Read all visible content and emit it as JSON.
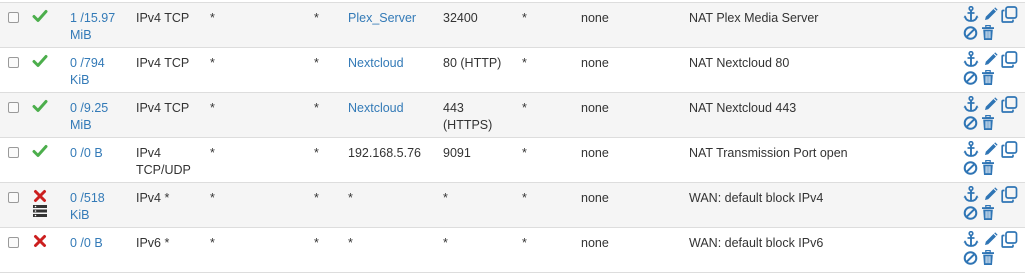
{
  "colors": {
    "link": "#337ab7",
    "pass": "#4cae4c",
    "block": "#cc1f1f",
    "action_icon": "#2f75b5"
  },
  "rules": [
    {
      "action": "pass",
      "log": false,
      "states_line1": "1 /15.97",
      "states_line2": "MiB",
      "protocol_line1": "IPv4 TCP",
      "protocol_line2": "",
      "source": "*",
      "port": "*",
      "destination": "Plex_Server",
      "destination_is_link": true,
      "dest_port_line1": "32400",
      "dest_port_line2": "",
      "gateway": "*",
      "queue": "none",
      "description": "NAT Plex Media Server"
    },
    {
      "action": "pass",
      "log": false,
      "states_line1": "0 /794",
      "states_line2": "KiB",
      "protocol_line1": "IPv4 TCP",
      "protocol_line2": "",
      "source": "*",
      "port": "*",
      "destination": "Nextcloud",
      "destination_is_link": true,
      "dest_port_line1": "80 (HTTP)",
      "dest_port_line2": "",
      "gateway": "*",
      "queue": "none",
      "description": "NAT Nextcloud 80"
    },
    {
      "action": "pass",
      "log": false,
      "states_line1": "0 /9.25",
      "states_line2": "MiB",
      "protocol_line1": "IPv4 TCP",
      "protocol_line2": "",
      "source": "*",
      "port": "*",
      "destination": "Nextcloud",
      "destination_is_link": true,
      "dest_port_line1": "443",
      "dest_port_line2": "(HTTPS)",
      "gateway": "*",
      "queue": "none",
      "description": "NAT Nextcloud 443"
    },
    {
      "action": "pass",
      "log": false,
      "states_line1": "0 /0 B",
      "states_line2": "",
      "protocol_line1": "IPv4",
      "protocol_line2": "TCP/UDP",
      "source": "*",
      "port": "*",
      "destination": "192.168.5.76",
      "destination_is_link": false,
      "dest_port_line1": "9091",
      "dest_port_line2": "",
      "gateway": "*",
      "queue": "none",
      "description": "NAT Transmission Port open"
    },
    {
      "action": "block",
      "log": true,
      "states_line1": "0 /518",
      "states_line2": "KiB",
      "protocol_line1": "IPv4 *",
      "protocol_line2": "",
      "source": "*",
      "port": "*",
      "destination": "*",
      "destination_is_link": false,
      "dest_port_line1": "*",
      "dest_port_line2": "",
      "gateway": "*",
      "queue": "none",
      "description": "WAN: default block IPv4"
    },
    {
      "action": "block",
      "log": false,
      "states_line1": "0 /0 B",
      "states_line2": "",
      "protocol_line1": "IPv6 *",
      "protocol_line2": "",
      "source": "*",
      "port": "*",
      "destination": "*",
      "destination_is_link": false,
      "dest_port_line1": "*",
      "dest_port_line2": "",
      "gateway": "*",
      "queue": "none",
      "description": "WAN: default block IPv6"
    }
  ]
}
